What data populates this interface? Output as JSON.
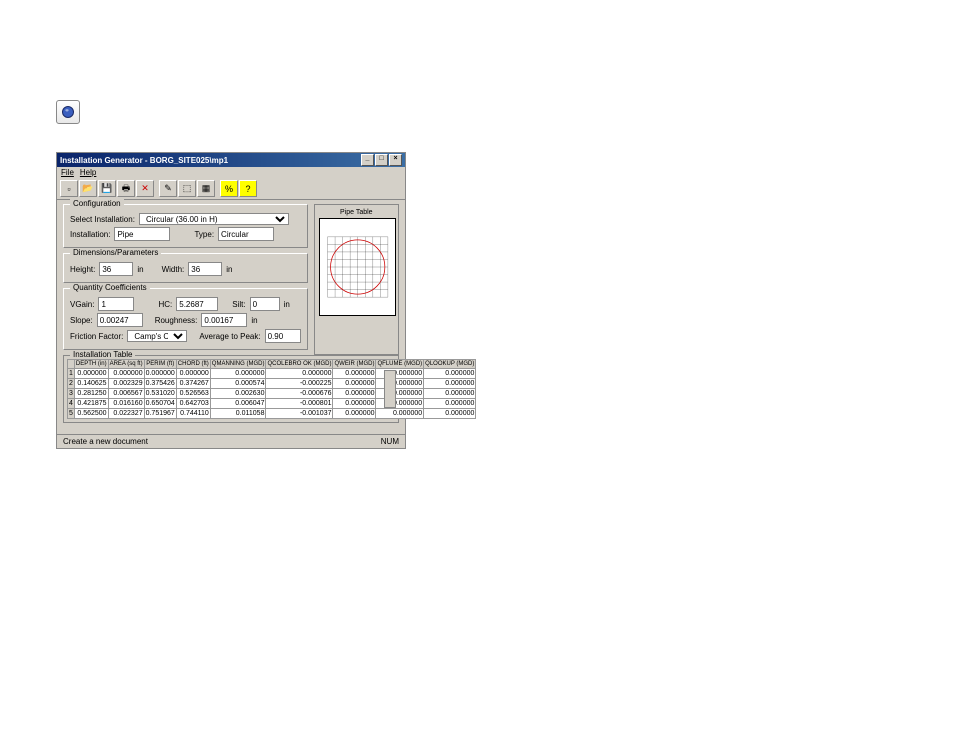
{
  "window": {
    "title": "Installation Generator - BORG_SITE025\\mp1",
    "menu": [
      "File",
      "Help"
    ],
    "status_left": "Create a new document",
    "status_right": "NUM"
  },
  "toolbar_icons": [
    "new-icon",
    "open-icon",
    "save-icon",
    "print-icon",
    "delete-icon",
    "",
    "edit-icon",
    "chart-icon",
    "table-icon",
    "",
    "percent-icon",
    "help-icon"
  ],
  "configuration": {
    "legend": "Configuration",
    "select_label": "Select Installation:",
    "select_value": "Circular (36.00 in H)",
    "installation_label": "Installation:",
    "installation_value": "Pipe",
    "type_label": "Type:",
    "type_value": "Circular"
  },
  "dimensions": {
    "legend": "Dimensions/Parameters",
    "height_label": "Height:",
    "height_value": "36",
    "height_unit": "in",
    "width_label": "Width:",
    "width_value": "36",
    "width_unit": "in"
  },
  "quantity": {
    "legend": "Quantity Coefficients",
    "vgain_label": "VGain:",
    "vgain_value": "1",
    "hc_label": "HC:",
    "hc_value": "5.2687",
    "silt_label": "Silt:",
    "silt_value": "0",
    "silt_unit": "in",
    "slope_label": "Slope:",
    "slope_value": "0.00247",
    "rough_label": "Roughness:",
    "rough_value": "0.00167",
    "rough_unit": "in",
    "friction_label": "Friction Factor:",
    "friction_value": "Camp's Curve",
    "avg_label": "Average to Peak:",
    "avg_value": "0.90"
  },
  "chart": {
    "title": "Pipe Table"
  },
  "chart_data": {
    "type": "line",
    "title": "Pipe Table",
    "xlabel": "",
    "ylabel": "",
    "xlim": [
      -20,
      20
    ],
    "ylim": [
      -20,
      20
    ],
    "shape": "circle",
    "radius": 18
  },
  "itable": {
    "legend": "Installation Table",
    "headers": [
      "",
      "DEPTH (in)",
      "AREA (sq ft)",
      "PERIM (ft)",
      "CHORD (ft)",
      "QMANNING (MGD)",
      "QCOLEBRO OK (MGD)",
      "QWEIR (MGD)",
      "QFLUME (MGD)",
      "QLOOKUP (MGD)"
    ],
    "rows": [
      [
        "1",
        "0.000000",
        "0.000000",
        "0.000000",
        "0.000000",
        "0.000000",
        "0.000000",
        "0.000000",
        "0.000000",
        "0.000000"
      ],
      [
        "2",
        "0.140625",
        "0.002329",
        "0.375426",
        "0.374267",
        "0.000574",
        "-0.000225",
        "0.000000",
        "0.000000",
        "0.000000"
      ],
      [
        "3",
        "0.281250",
        "0.006567",
        "0.531020",
        "0.526563",
        "0.002630",
        "-0.000676",
        "0.000000",
        "0.000000",
        "0.000000"
      ],
      [
        "4",
        "0.421875",
        "0.016160",
        "0.650704",
        "0.642703",
        "0.006047",
        "-0.000801",
        "0.000000",
        "0.000000",
        "0.000000"
      ],
      [
        "5",
        "0.562500",
        "0.022327",
        "0.751967",
        "0.744110",
        "0.011058",
        "-0.001037",
        "0.000000",
        "0.000000",
        "0.000000"
      ]
    ]
  }
}
